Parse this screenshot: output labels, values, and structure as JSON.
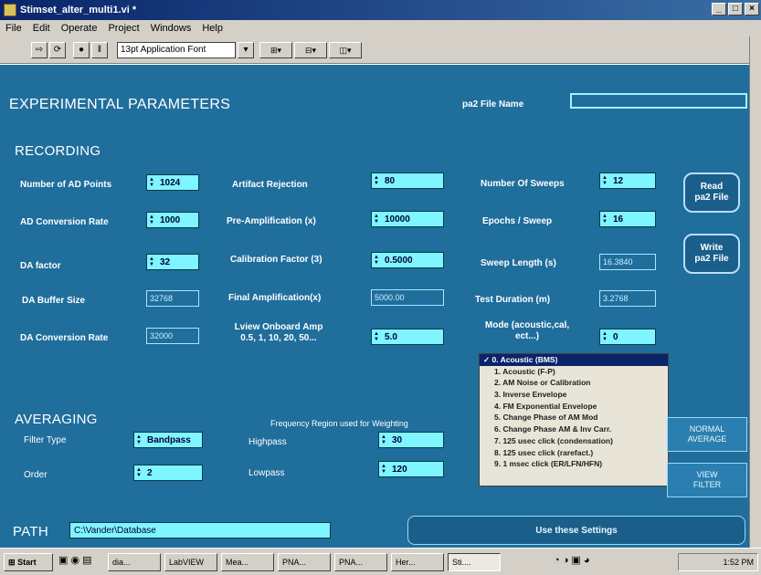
{
  "window": {
    "title": "Stimset_alter_multi1.vi *"
  },
  "menu": [
    "File",
    "Edit",
    "Operate",
    "Project",
    "Windows",
    "Help"
  ],
  "toolbar": {
    "font": "13pt Application Font"
  },
  "panel": {
    "title": "EXPERIMENTAL PARAMETERS",
    "file_name_label": "pa2 File Name",
    "file_name_value": "",
    "recording_heading": "RECORDING",
    "averaging_heading": "AVERAGING",
    "path_label": "PATH",
    "path_value": "C:\\Vander\\Database",
    "fields": {
      "num_ad_points": {
        "label": "Number of AD Points",
        "value": "1024"
      },
      "ad_conversion_rate": {
        "label": "AD Conversion Rate",
        "value": "1000"
      },
      "da_factor": {
        "label": "DA factor",
        "value": "32"
      },
      "da_buffer_size": {
        "label": "DA Buffer Size",
        "value": "32768"
      },
      "da_conversion_rate": {
        "label": "DA Conversion Rate",
        "value": "32000"
      },
      "artifact_rejection": {
        "label": "Artifact Rejection",
        "value": "80"
      },
      "pre_amplification": {
        "label": "Pre-Amplification (x)",
        "value": "10000"
      },
      "calibration_factor": {
        "label": "Calibration Factor (3)",
        "value": "0.5000"
      },
      "final_amplification": {
        "label": "Final Amplification(x)",
        "value": "5000.00"
      },
      "onboard_amp": {
        "label": "Lview Onboard Amp\n0.5, 1, 10, 20, 50...",
        "value": "5.0"
      },
      "num_sweeps": {
        "label": "Number Of Sweeps",
        "value": "12"
      },
      "epochs_per_sweep": {
        "label": "Epochs / Sweep",
        "value": "16"
      },
      "sweep_length": {
        "label": "Sweep Length (s)",
        "value": "16.3840"
      },
      "test_duration": {
        "label": "Test Duration (m)",
        "value": "3.2768"
      },
      "mode": {
        "label": "Mode (acoustic,cal,\nect...)",
        "value": "0"
      }
    },
    "mode_options": [
      "0. Acoustic (BMS)",
      "1. Acoustic (F-P)",
      "2. AM Noise or Calibration",
      "3. Inverse Envelope",
      "4. FM Exponential Envelope",
      "5. Change Phase of AM Mod",
      "6. Change Phase AM & Inv Carr.",
      "7. 125 usec click (condensation)",
      "8. 125 usec click (rarefact.)",
      "9. 1 msec click (ER/LFN/HFN)"
    ],
    "averaging": {
      "filter_type_label": "Filter Type",
      "filter_type_value": "Bandpass",
      "order_label": "Order",
      "order_value": "2",
      "freq_region_label": "Frequency Region used for Weighting",
      "highpass_label": "Highpass",
      "highpass_value": "30",
      "lowpass_label": "Lowpass",
      "lowpass_value": "120"
    },
    "buttons": {
      "read_pa2": "Read\npa2 File",
      "write_pa2": "Write\npa2 File",
      "normal_average": "NORMAL\nAVERAGE",
      "view_filter": "VIEW\nFILTER",
      "use_settings": "Use these Settings"
    }
  },
  "taskbar": {
    "start": "Start",
    "tasks": [
      "dia...",
      "LabVIEW",
      "Mea...",
      "PNA...",
      "PNA...",
      "Her...",
      "Sti...."
    ],
    "clock": "1:52 PM"
  }
}
